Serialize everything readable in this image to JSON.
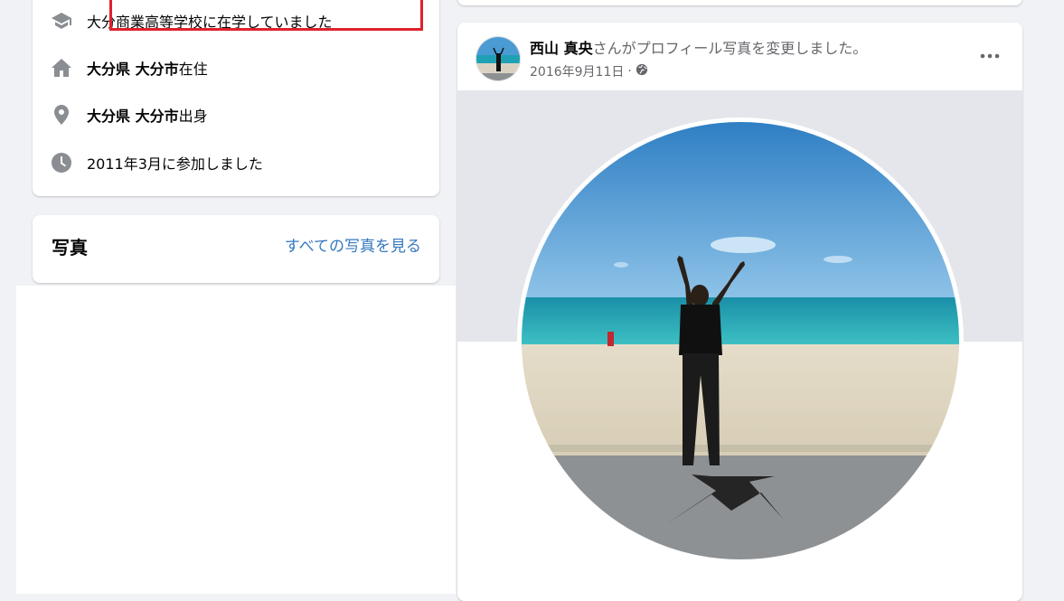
{
  "intro": {
    "education": "大分商業高等学校に在学していました",
    "lives_bold": "大分県 大分市",
    "lives_suffix": "在住",
    "from_bold": "大分県 大分市",
    "from_suffix": "出身",
    "joined": "2011年3月に参加しました",
    "icons": [
      "graduation-cap-icon",
      "home-icon",
      "location-pin-icon",
      "clock-icon"
    ]
  },
  "photos": {
    "title": "写真",
    "see_all": "すべての写真を見る"
  },
  "post": {
    "author": "西山 真央",
    "action": "さんがプロフィール写真を変更しました。",
    "date": "2016年9月11日",
    "separator": "·",
    "privacy_icon": "globe-icon",
    "more_icon": "more-options-icon"
  },
  "colors": {
    "highlight": "#e0212b",
    "link": "#3578c0",
    "secondary_text": "#65676b",
    "icon_grey": "#8a8d91"
  }
}
